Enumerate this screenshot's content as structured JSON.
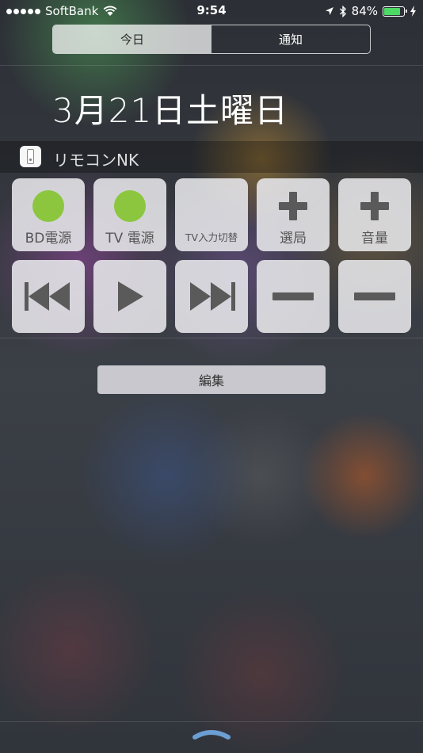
{
  "status_bar": {
    "carrier": "SoftBank",
    "time": "9:54",
    "battery_percent_text": "84%",
    "battery_level": 0.84
  },
  "segmented": {
    "today_label": "今日",
    "notifications_label": "通知"
  },
  "date_label": "3月21日土曜日",
  "widget": {
    "title": "リモコンNK",
    "buttons_row1": [
      {
        "label": "BD電源",
        "icon": "green-dot-icon"
      },
      {
        "label": "TV 電源",
        "icon": "green-dot-icon"
      },
      {
        "label": "TV入力切替",
        "icon": ""
      },
      {
        "label": "選局",
        "icon": "plus-icon"
      },
      {
        "label": "音量",
        "icon": "plus-icon"
      }
    ],
    "buttons_row2": [
      {
        "icon": "skip-back-icon"
      },
      {
        "icon": "play-icon"
      },
      {
        "icon": "skip-forward-icon"
      },
      {
        "icon": "minus-icon"
      },
      {
        "icon": "minus-icon"
      }
    ]
  },
  "edit_label": "編集",
  "colors": {
    "power_dot": "#8cc63f",
    "battery_fill": "#4cd964",
    "grabber": "#6b9fd4"
  }
}
